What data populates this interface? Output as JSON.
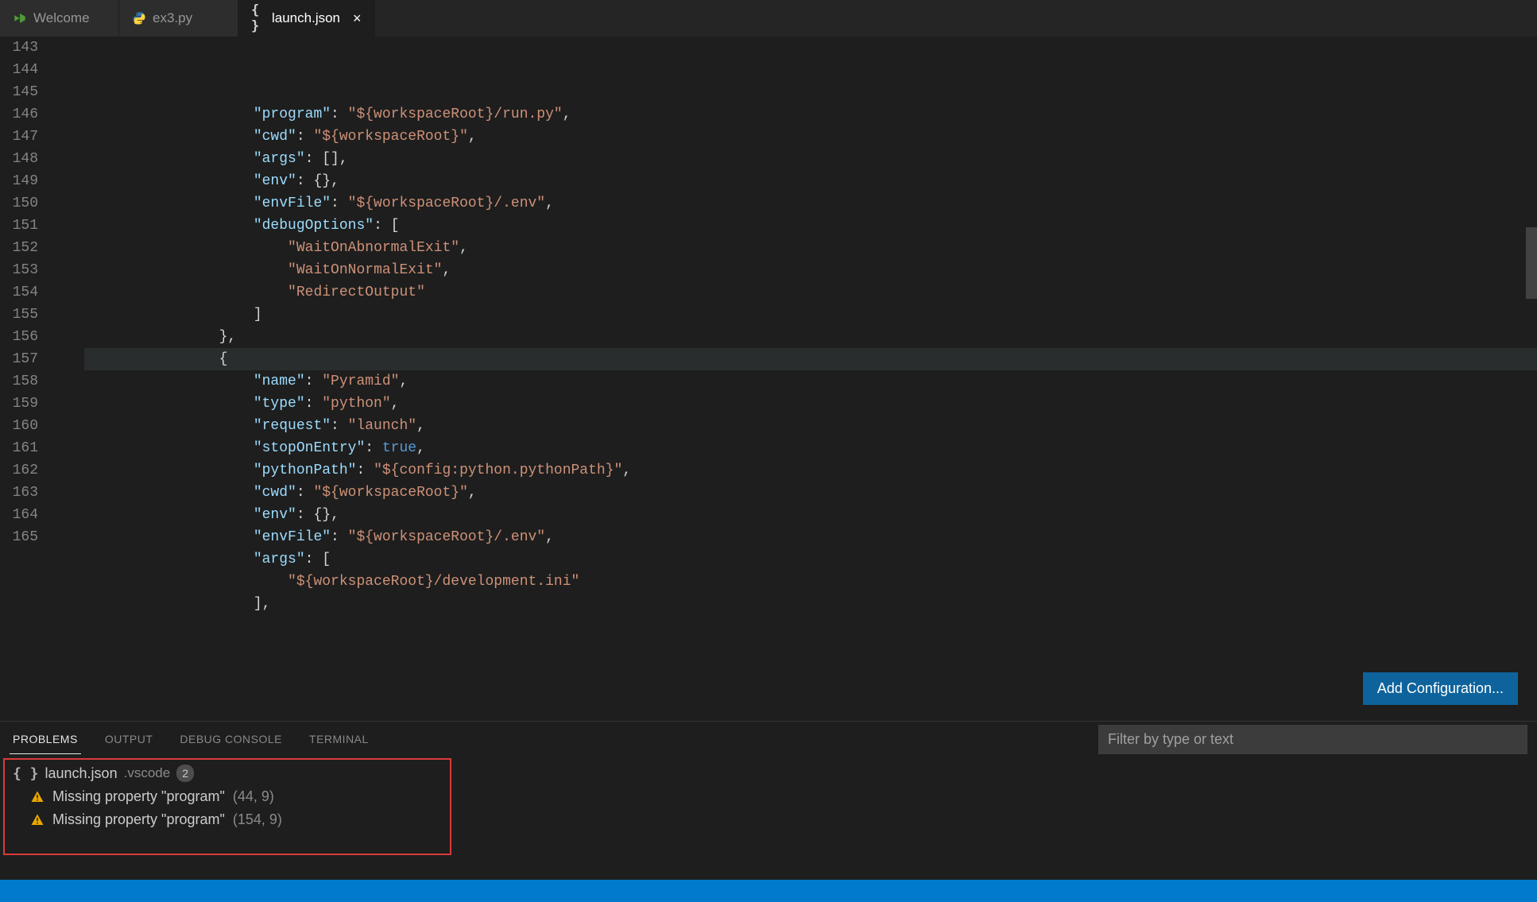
{
  "tabs": [
    {
      "label": "Welcome",
      "icon": "vs"
    },
    {
      "label": "ex3.py",
      "icon": "python"
    },
    {
      "label": "launch.json",
      "icon": "json",
      "active": true,
      "dirty": false,
      "closable": true
    }
  ],
  "editor": {
    "startLine": 143,
    "highlightedLine": 154,
    "addConfigLabel": "Add Configuration...",
    "lines": [
      {
        "n": 143,
        "indent": 16,
        "tokens": [
          [
            "key",
            "\"program\""
          ],
          [
            "pun",
            ": "
          ],
          [
            "str",
            "\"${workspaceRoot}/run.py\""
          ],
          [
            "pun",
            ","
          ]
        ]
      },
      {
        "n": 144,
        "indent": 16,
        "tokens": [
          [
            "key",
            "\"cwd\""
          ],
          [
            "pun",
            ": "
          ],
          [
            "str",
            "\"${workspaceRoot}\""
          ],
          [
            "pun",
            ","
          ]
        ]
      },
      {
        "n": 145,
        "indent": 16,
        "tokens": [
          [
            "key",
            "\"args\""
          ],
          [
            "pun",
            ": []"
          ],
          [
            "pun",
            ","
          ]
        ]
      },
      {
        "n": 146,
        "indent": 16,
        "tokens": [
          [
            "key",
            "\"env\""
          ],
          [
            "pun",
            ": {}"
          ],
          [
            "pun",
            ","
          ]
        ]
      },
      {
        "n": 147,
        "indent": 16,
        "tokens": [
          [
            "key",
            "\"envFile\""
          ],
          [
            "pun",
            ": "
          ],
          [
            "str",
            "\"${workspaceRoot}/.env\""
          ],
          [
            "pun",
            ","
          ]
        ]
      },
      {
        "n": 148,
        "indent": 16,
        "tokens": [
          [
            "key",
            "\"debugOptions\""
          ],
          [
            "pun",
            ": ["
          ]
        ]
      },
      {
        "n": 149,
        "indent": 20,
        "tokens": [
          [
            "str",
            "\"WaitOnAbnormalExit\""
          ],
          [
            "pun",
            ","
          ]
        ]
      },
      {
        "n": 150,
        "indent": 20,
        "tokens": [
          [
            "str",
            "\"WaitOnNormalExit\""
          ],
          [
            "pun",
            ","
          ]
        ]
      },
      {
        "n": 151,
        "indent": 20,
        "tokens": [
          [
            "str",
            "\"RedirectOutput\""
          ]
        ]
      },
      {
        "n": 152,
        "indent": 16,
        "tokens": [
          [
            "pun",
            "]"
          ]
        ]
      },
      {
        "n": 153,
        "indent": 12,
        "tokens": [
          [
            "pun",
            "},"
          ]
        ]
      },
      {
        "n": 154,
        "indent": 12,
        "tokens": [
          [
            "pun",
            "{"
          ]
        ],
        "hl": true
      },
      {
        "n": 155,
        "indent": 16,
        "tokens": [
          [
            "key",
            "\"name\""
          ],
          [
            "pun",
            ": "
          ],
          [
            "str",
            "\"Pyramid\""
          ],
          [
            "pun",
            ","
          ]
        ]
      },
      {
        "n": 156,
        "indent": 16,
        "tokens": [
          [
            "key",
            "\"type\""
          ],
          [
            "pun",
            ": "
          ],
          [
            "str",
            "\"python\""
          ],
          [
            "pun",
            ","
          ]
        ]
      },
      {
        "n": 157,
        "indent": 16,
        "tokens": [
          [
            "key",
            "\"request\""
          ],
          [
            "pun",
            ": "
          ],
          [
            "str",
            "\"launch\""
          ],
          [
            "pun",
            ","
          ]
        ]
      },
      {
        "n": 158,
        "indent": 16,
        "tokens": [
          [
            "key",
            "\"stopOnEntry\""
          ],
          [
            "pun",
            ": "
          ],
          [
            "bool",
            "true"
          ],
          [
            "pun",
            ","
          ]
        ]
      },
      {
        "n": 159,
        "indent": 16,
        "tokens": [
          [
            "key",
            "\"pythonPath\""
          ],
          [
            "pun",
            ": "
          ],
          [
            "str",
            "\"${config:python.pythonPath}\""
          ],
          [
            "pun",
            ","
          ]
        ]
      },
      {
        "n": 160,
        "indent": 16,
        "tokens": [
          [
            "key",
            "\"cwd\""
          ],
          [
            "pun",
            ": "
          ],
          [
            "str",
            "\"${workspaceRoot}\""
          ],
          [
            "pun",
            ","
          ]
        ]
      },
      {
        "n": 161,
        "indent": 16,
        "tokens": [
          [
            "key",
            "\"env\""
          ],
          [
            "pun",
            ": {}"
          ],
          [
            "pun",
            ","
          ]
        ]
      },
      {
        "n": 162,
        "indent": 16,
        "tokens": [
          [
            "key",
            "\"envFile\""
          ],
          [
            "pun",
            ": "
          ],
          [
            "str",
            "\"${workspaceRoot}/.env\""
          ],
          [
            "pun",
            ","
          ]
        ]
      },
      {
        "n": 163,
        "indent": 16,
        "tokens": [
          [
            "key",
            "\"args\""
          ],
          [
            "pun",
            ": ["
          ]
        ]
      },
      {
        "n": 164,
        "indent": 20,
        "tokens": [
          [
            "str",
            "\"${workspaceRoot}/development.ini\""
          ]
        ]
      },
      {
        "n": 165,
        "indent": 16,
        "tokens": [
          [
            "pun",
            "],"
          ]
        ]
      }
    ]
  },
  "panel": {
    "tabs": [
      {
        "label": "PROBLEMS",
        "id": "problems",
        "active": true
      },
      {
        "label": "OUTPUT",
        "id": "output"
      },
      {
        "label": "DEBUG CONSOLE",
        "id": "debug-console"
      },
      {
        "label": "TERMINAL",
        "id": "terminal"
      }
    ],
    "filterPlaceholder": "Filter by type or text",
    "problems": {
      "file": "launch.json",
      "folder": ".vscode",
      "count": "2",
      "items": [
        {
          "message": "Missing property \"program\"",
          "location": "(44, 9)"
        },
        {
          "message": "Missing property \"program\"",
          "location": "(154, 9)"
        }
      ]
    }
  }
}
